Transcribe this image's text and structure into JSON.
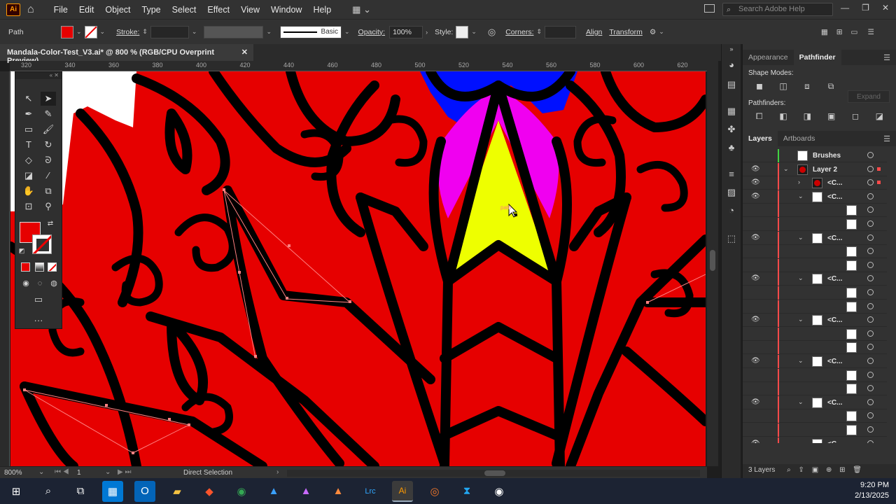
{
  "app": {
    "logo_text": "Ai"
  },
  "menu": [
    "File",
    "Edit",
    "Object",
    "Type",
    "Select",
    "Effect",
    "View",
    "Window",
    "Help"
  ],
  "search": {
    "placeholder": "Search Adobe Help"
  },
  "control_bar": {
    "object_type": "Path",
    "stroke_label": "Stroke:",
    "brush_label": "Basic",
    "opacity_label": "Opacity:",
    "opacity_value": "100%",
    "style_label": "Style:",
    "corners_label": "Corners:",
    "align_label": "Align",
    "transform_label": "Transform",
    "fill_color": "#e60000"
  },
  "document_tab": {
    "title": "Mandala-Color-Test_V3.ai* @ 800 % (RGB/CPU Overprint Preview)",
    "close": "✕"
  },
  "ruler": {
    "ticks": [
      "320",
      "340",
      "360",
      "380",
      "400",
      "420",
      "440",
      "460",
      "480",
      "500",
      "520",
      "540",
      "560",
      "580",
      "600",
      "620"
    ]
  },
  "status": {
    "zoom": "800%",
    "artboard": "1",
    "tool": "Direct Selection"
  },
  "cursor_label": "path",
  "panels": {
    "tabs": [
      "Appearance",
      "Pathfinder"
    ],
    "shape_modes": "Shape Modes:",
    "pathfinders": "Pathfinders:",
    "expand": "Expand",
    "layer_tabs": [
      "Layers",
      "Artboards"
    ],
    "layers_count": "3 Layers"
  },
  "layers": [
    {
      "name": "Brushes",
      "indent": 0,
      "eye": false,
      "expand": "",
      "thumb": "white",
      "bar": "#41d341"
    },
    {
      "name": "Layer 2",
      "indent": 0,
      "eye": true,
      "expand": "⌄",
      "thumb": "dark",
      "bar": "#ff4a4a"
    },
    {
      "name": "<C...",
      "indent": 1,
      "eye": true,
      "expand": "›",
      "thumb": "dark",
      "bar": "#ff4a4a"
    },
    {
      "name": "<C...",
      "indent": 1,
      "eye": true,
      "expand": "⌄",
      "thumb": "white",
      "bar": "#ff4a4a"
    },
    {
      "name": "",
      "indent": 2,
      "eye": false,
      "expand": "",
      "thumb": "white",
      "bar": "#ff4a4a"
    },
    {
      "name": "",
      "indent": 2,
      "eye": false,
      "expand": "",
      "thumb": "white",
      "bar": "#ff4a4a"
    },
    {
      "name": "<C...",
      "indent": 1,
      "eye": true,
      "expand": "⌄",
      "thumb": "white",
      "bar": "#ff4a4a"
    },
    {
      "name": "",
      "indent": 2,
      "eye": false,
      "expand": "",
      "thumb": "white",
      "bar": "#ff4a4a"
    },
    {
      "name": "",
      "indent": 2,
      "eye": false,
      "expand": "",
      "thumb": "white",
      "bar": "#ff4a4a"
    },
    {
      "name": "<C...",
      "indent": 1,
      "eye": true,
      "expand": "⌄",
      "thumb": "white",
      "bar": "#ff4a4a"
    },
    {
      "name": "",
      "indent": 2,
      "eye": false,
      "expand": "",
      "thumb": "white",
      "bar": "#ff4a4a"
    },
    {
      "name": "",
      "indent": 2,
      "eye": false,
      "expand": "",
      "thumb": "white",
      "bar": "#ff4a4a"
    },
    {
      "name": "<C...",
      "indent": 1,
      "eye": true,
      "expand": "⌄",
      "thumb": "white",
      "bar": "#ff4a4a"
    },
    {
      "name": "",
      "indent": 2,
      "eye": false,
      "expand": "",
      "thumb": "white",
      "bar": "#ff4a4a"
    },
    {
      "name": "",
      "indent": 2,
      "eye": false,
      "expand": "",
      "thumb": "white",
      "bar": "#ff4a4a"
    },
    {
      "name": "<C...",
      "indent": 1,
      "eye": true,
      "expand": "⌄",
      "thumb": "white",
      "bar": "#ff4a4a"
    },
    {
      "name": "",
      "indent": 2,
      "eye": false,
      "expand": "",
      "thumb": "white",
      "bar": "#ff4a4a"
    },
    {
      "name": "",
      "indent": 2,
      "eye": false,
      "expand": "",
      "thumb": "white",
      "bar": "#ff4a4a"
    },
    {
      "name": "<C...",
      "indent": 1,
      "eye": true,
      "expand": "⌄",
      "thumb": "white",
      "bar": "#ff4a4a"
    },
    {
      "name": "",
      "indent": 2,
      "eye": false,
      "expand": "",
      "thumb": "white",
      "bar": "#ff4a4a"
    },
    {
      "name": "",
      "indent": 2,
      "eye": false,
      "expand": "",
      "thumb": "white",
      "bar": "#ff4a4a"
    },
    {
      "name": "<C...",
      "indent": 1,
      "eye": true,
      "expand": "⌄",
      "thumb": "white",
      "bar": "#ff4a4a"
    }
  ],
  "taskbar": {
    "time": "9:20 PM",
    "date": "2/13/2025"
  },
  "artwork_colors": {
    "red": "#e60000",
    "black": "#000000",
    "blue": "#0010ff",
    "magenta": "#f000f0",
    "yellow": "#eeff00"
  }
}
